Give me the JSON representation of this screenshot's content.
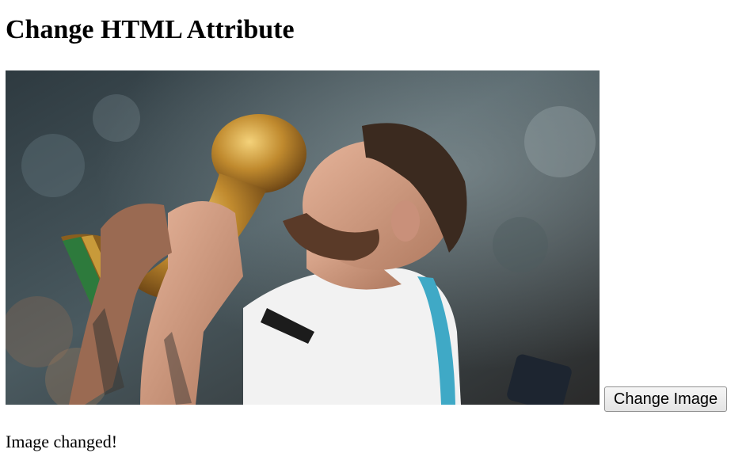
{
  "page": {
    "title": "Change HTML Attribute",
    "status_message": "Image changed!"
  },
  "image": {
    "alt": "Player kissing the World Cup trophy"
  },
  "controls": {
    "change_image_label": "Change Image"
  },
  "colors": {
    "button_border": "#8f8f8f",
    "trophy_gold": "#c89a3a",
    "trophy_green": "#2d7a3c",
    "jersey_blue": "#3fa9c6",
    "jersey_white": "#f2f2f2"
  }
}
